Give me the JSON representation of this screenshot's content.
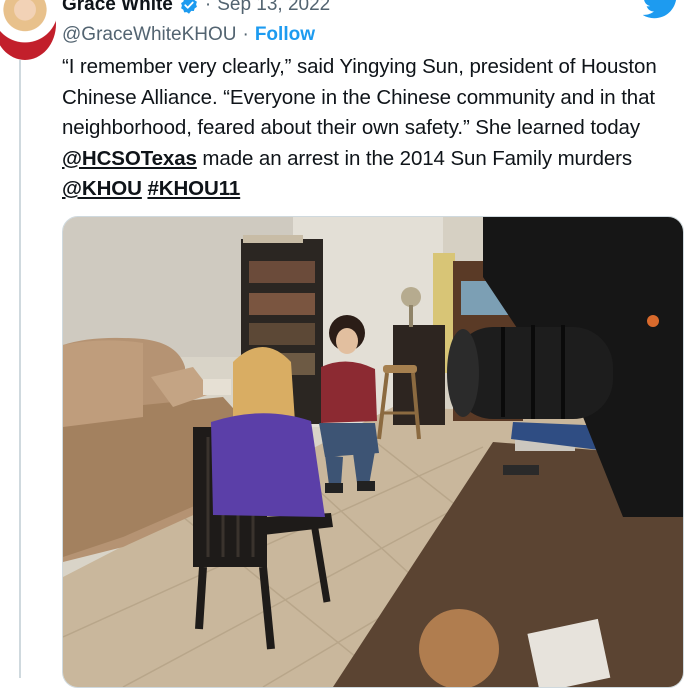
{
  "tweet": {
    "author": {
      "display_name": "Grace White",
      "handle": "@GraceWhiteKHOU",
      "verified": true
    },
    "separator": "·",
    "date": "Sep 13, 2022",
    "follow_label": "Follow",
    "text": {
      "part1": "“I remember very clearly,” said Yingying Sun, president of Houston Chinese Alliance. “Everyone in the Chinese community and in that neighborhood, feared about their own safety.” She learned today ",
      "mention1": "@HCSOTexas",
      "part2": " made an arrest in the 2014 Sun Family murders ",
      "mention2": "@KHOU",
      "space": " ",
      "hashtag": "#KHOU11"
    },
    "media": {
      "type": "photo",
      "scene": "interview-in-living-room"
    }
  },
  "icons": {
    "verified": "verified-badge-icon",
    "logo": "twitter-bird-icon"
  },
  "colors": {
    "link_blue": "#1d9bf0",
    "secondary_text": "#536471",
    "primary_text": "#0f1419",
    "border": "#cfd9de"
  }
}
